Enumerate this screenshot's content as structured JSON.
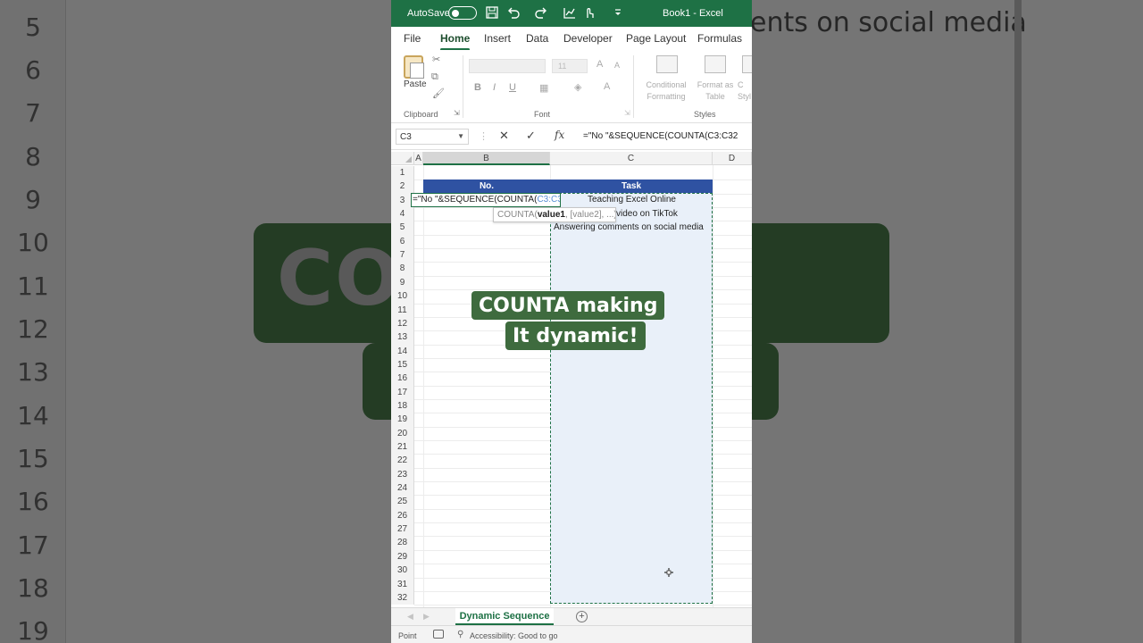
{
  "background": {
    "row_numbers": [
      "5",
      "6",
      "7",
      "8",
      "9",
      "10",
      "11",
      "12",
      "13",
      "14",
      "15",
      "16",
      "17",
      "18",
      "19"
    ],
    "header_text": "ents on social media",
    "pill_text": "CO          king"
  },
  "titlebar": {
    "autosave_label": "AutoSave",
    "title": "Book1  -  Excel"
  },
  "tabs": [
    "File",
    "Home",
    "Insert",
    "Data",
    "Developer",
    "Page Layout",
    "Formulas"
  ],
  "active_tab": "Home",
  "ribbon": {
    "paste_label": "Paste",
    "font_size": "11",
    "clipboard_label": "Clipboard",
    "font_label": "Font",
    "styles_label": "Styles",
    "conditional_formatting": "Conditional\nFormatting",
    "format_as_table": "Format as\nTable",
    "cell_styles": "C\nStyl",
    "bold": "B",
    "italic": "I",
    "underline": "U",
    "grow_font": "A",
    "shrink_font": "A"
  },
  "formula_bar": {
    "name_box": "C3",
    "formula": "=\"No \"&SEQUENCE(COUNTA(C3:C32"
  },
  "grid": {
    "columns": [
      "A",
      "B",
      "C",
      "D"
    ],
    "rows": [
      "1",
      "2",
      "3",
      "4",
      "5",
      "6",
      "7",
      "8",
      "9",
      "10",
      "11",
      "12",
      "13",
      "14",
      "15",
      "16",
      "17",
      "18",
      "19",
      "20",
      "21",
      "22",
      "23",
      "24",
      "25",
      "26",
      "27",
      "28",
      "29",
      "30",
      "31",
      "32"
    ],
    "header_no": "No.",
    "header_task": "Task",
    "tasks": [
      "Teaching Excel Online",
      "video on TikTok",
      "Answering comments on social media"
    ],
    "editing_prefix": "=\"No \"&SEQUENCE(COUNTA(",
    "editing_ref": "C3:C32",
    "tooltip_func": "COUNTA(",
    "tooltip_arg": "value1",
    "tooltip_rest": ", [value2], ...)"
  },
  "sheet": {
    "tab_name": "Dynamic Sequence",
    "add_label": "+"
  },
  "status": {
    "mode": "Point",
    "accessibility": "Accessibility: Good to go"
  },
  "caption": {
    "line1": "COUNTA making",
    "line2": "It dynamic!"
  },
  "colors": {
    "excel_green": "#1e7145",
    "header_blue": "#2f52a2",
    "caption_green": "#3e6b3e"
  }
}
